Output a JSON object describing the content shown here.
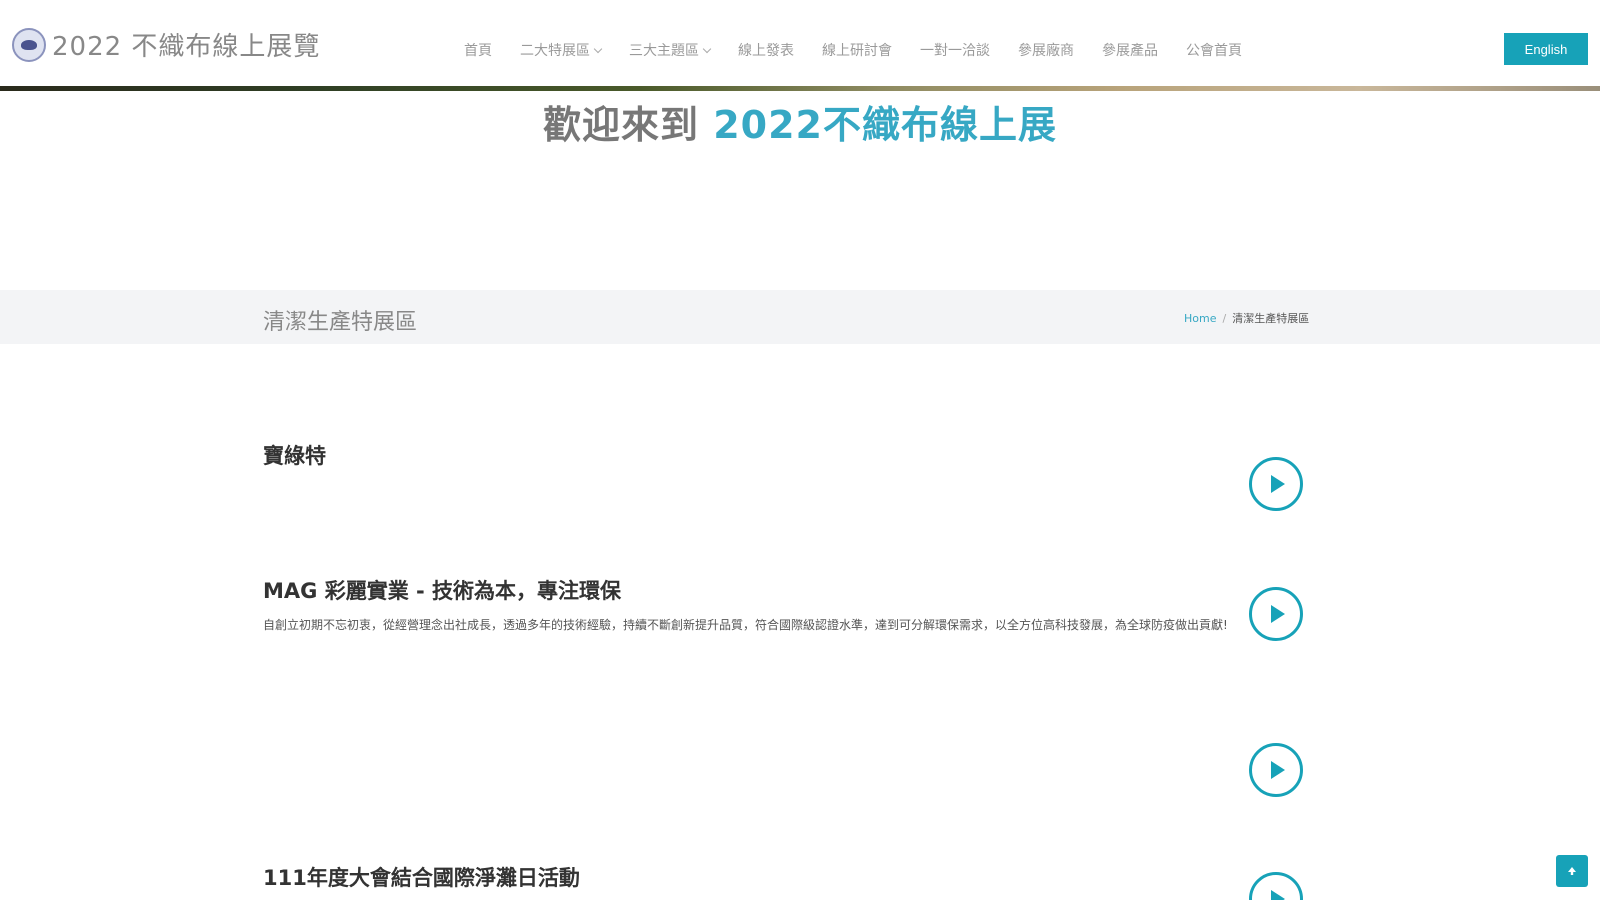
{
  "header": {
    "logo_text": "2022 不織布線上展覽",
    "nav": [
      {
        "label": "首頁",
        "dropdown": false
      },
      {
        "label": "二大特展區",
        "dropdown": true
      },
      {
        "label": "三大主題區",
        "dropdown": true
      },
      {
        "label": "線上發表",
        "dropdown": false
      },
      {
        "label": "線上研討會",
        "dropdown": false
      },
      {
        "label": "一對一洽談",
        "dropdown": false
      },
      {
        "label": "參展廠商",
        "dropdown": false
      },
      {
        "label": "參展產品",
        "dropdown": false
      },
      {
        "label": "公會首頁",
        "dropdown": false
      }
    ],
    "lang_button": "English"
  },
  "welcome": {
    "prefix": "歡迎來到 ",
    "highlight": "2022不織布線上展"
  },
  "band": {
    "title": "清潔生產特展區",
    "breadcrumb_home": "Home",
    "breadcrumb_sep": "/",
    "breadcrumb_current": "清潔生產特展區"
  },
  "items": [
    {
      "title": "寶綠特",
      "desc": ""
    },
    {
      "title": "MAG 彩麗實業 - 技術為本，專注環保",
      "desc": "自創立初期不忘初衷，從經營理念出社成長，透過多年的技術經驗，持續不斷創新提升品質，符合國際級認證水準，達到可分解環保需求，以全方位高科技發展，為全球防疫做出貢獻!"
    },
    {
      "title": "",
      "desc": ""
    },
    {
      "title": "111年度大會結合國際淨灘日活動",
      "desc": ""
    }
  ],
  "colors": {
    "accent": "#17a2b8",
    "accent_text": "#37a8c4",
    "band_bg": "#f3f4f6"
  },
  "icons": {
    "play": "play-circle-icon",
    "back_to_top": "arrow-up-icon"
  }
}
